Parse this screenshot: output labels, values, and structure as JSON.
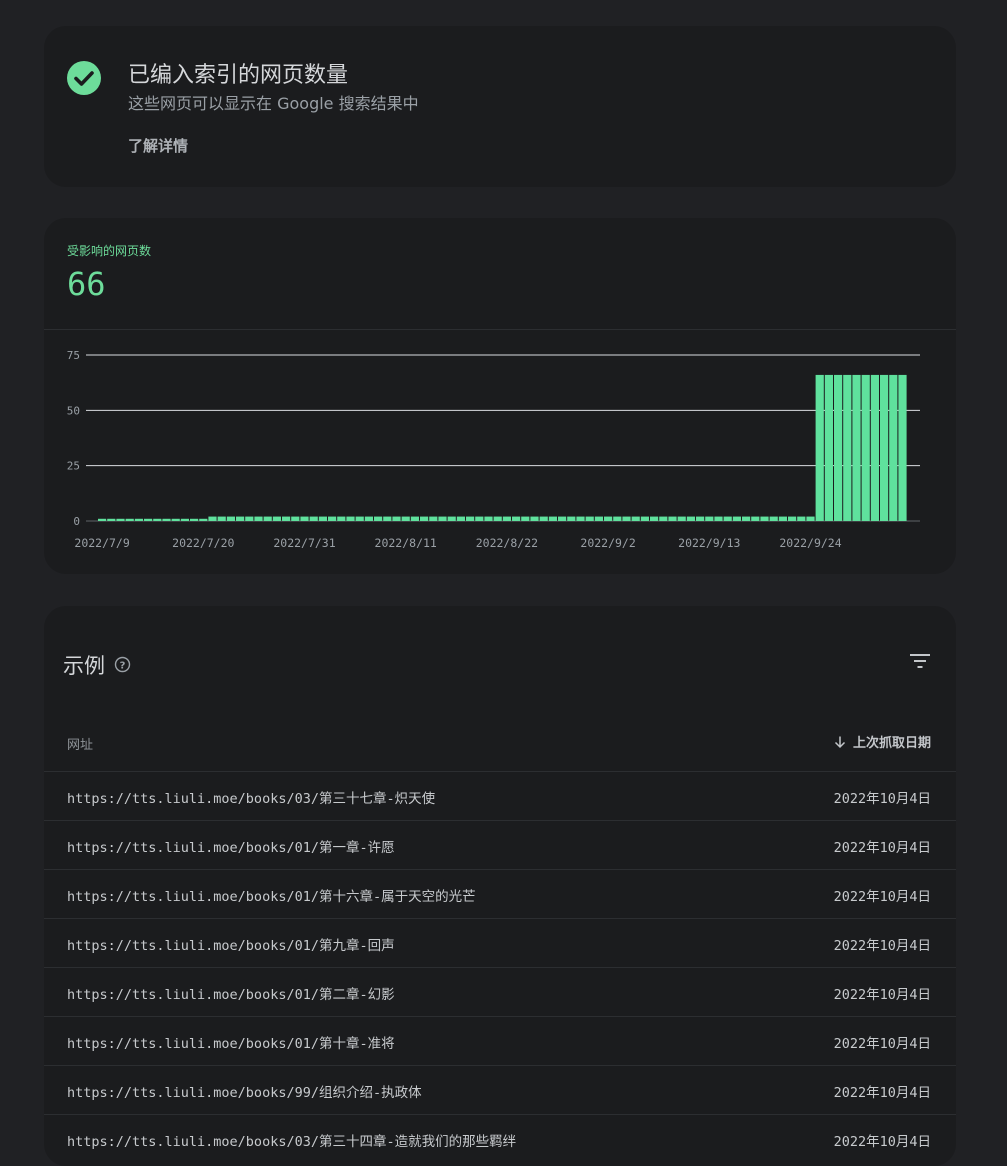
{
  "status": {
    "title": "已编入索引的网页数量",
    "subtitle": "这些网页可以显示在 Google 搜索结果中",
    "learn_more": "了解详情",
    "check_color": "#6ddc9a"
  },
  "affected": {
    "label": "受影响的网页数",
    "value": "66"
  },
  "chart_data": {
    "type": "bar",
    "x_tick_labels": [
      "2022/7/9",
      "2022/7/20",
      "2022/7/31",
      "2022/8/11",
      "2022/8/22",
      "2022/9/2",
      "2022/9/13",
      "2022/9/24"
    ],
    "y_tick_labels": [
      "0",
      "25",
      "50",
      "75"
    ],
    "ylim": [
      0,
      75
    ],
    "grid": true,
    "color": "#5fe19d",
    "series": [
      {
        "values": [
          1,
          1,
          1,
          1,
          1,
          1,
          1,
          1,
          1,
          1,
          1,
          1,
          2,
          2,
          2,
          2,
          2,
          2,
          2,
          2,
          2,
          2,
          2,
          2,
          2,
          2,
          2,
          2,
          2,
          2,
          2,
          2,
          2,
          2,
          2,
          2,
          2,
          2,
          2,
          2,
          2,
          2,
          2,
          2,
          2,
          2,
          2,
          2,
          2,
          2,
          2,
          2,
          2,
          2,
          2,
          2,
          2,
          2,
          2,
          2,
          2,
          2,
          2,
          2,
          2,
          2,
          2,
          2,
          2,
          2,
          2,
          2,
          2,
          2,
          2,
          2,
          2,
          2,
          66,
          66,
          66,
          66,
          66,
          66,
          66,
          66,
          66,
          66
        ]
      }
    ]
  },
  "examples": {
    "title": "示例",
    "col_url": "网址",
    "col_date": "上次抓取日期",
    "rows": [
      {
        "url": "https://tts.liuli.moe/books/03/第三十七章-炽天使",
        "date": "2022年10月4日"
      },
      {
        "url": "https://tts.liuli.moe/books/01/第一章-许愿",
        "date": "2022年10月4日"
      },
      {
        "url": "https://tts.liuli.moe/books/01/第十六章-属于天空的光芒",
        "date": "2022年10月4日"
      },
      {
        "url": "https://tts.liuli.moe/books/01/第九章-回声",
        "date": "2022年10月4日"
      },
      {
        "url": "https://tts.liuli.moe/books/01/第二章-幻影",
        "date": "2022年10月4日"
      },
      {
        "url": "https://tts.liuli.moe/books/01/第十章-准将",
        "date": "2022年10月4日"
      },
      {
        "url": "https://tts.liuli.moe/books/99/组织介绍-执政体",
        "date": "2022年10月4日"
      },
      {
        "url": "https://tts.liuli.moe/books/03/第三十四章-造就我们的那些羁绊",
        "date": "2022年10月4日"
      }
    ]
  }
}
